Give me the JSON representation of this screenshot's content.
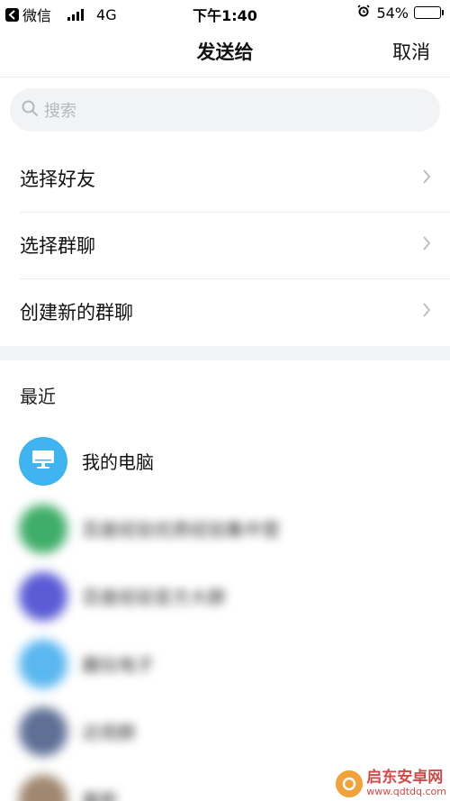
{
  "status_bar": {
    "carrier": "微信",
    "network": "4G",
    "time": "下午1:40",
    "battery": "54%",
    "battery_level": 0.54
  },
  "nav": {
    "title": "发送给",
    "cancel_label": "取消"
  },
  "search": {
    "placeholder": "搜索"
  },
  "menu": {
    "items": [
      {
        "label": "选择好友"
      },
      {
        "label": "选择群聊"
      },
      {
        "label": "创建新的群聊"
      }
    ]
  },
  "recent": {
    "title": "最近",
    "contacts": [
      {
        "name": "我的电脑",
        "avatar_color": "#3fb4f0",
        "icon": "monitor-icon"
      },
      {
        "name": "百度经验优质经验集中营",
        "avatar_color": "#3fae6a"
      },
      {
        "name": "百度经验官方大群",
        "avatar_color": "#5b5bd6"
      },
      {
        "name": "趣玩电子",
        "avatar_color": "#5ab7f0"
      },
      {
        "name": "达观群",
        "avatar_color": "#5f6f96"
      },
      {
        "name": "最新",
        "avatar_color": "#a08770"
      }
    ]
  },
  "watermark": {
    "name": "启东安卓网",
    "url": "www.qdtdq.com"
  }
}
